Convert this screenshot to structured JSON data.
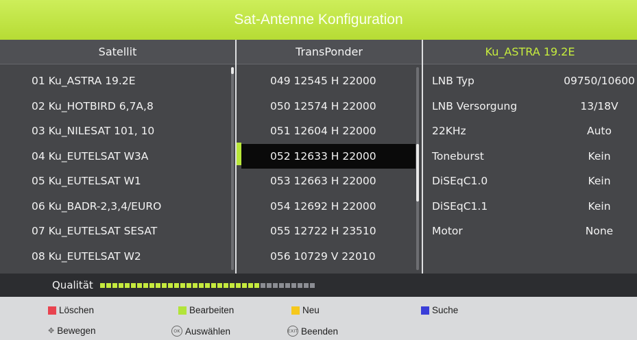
{
  "title": "Sat-Antenne Konfiguration",
  "columns": {
    "satellite_header": "Satellit",
    "transponder_header": "TransPonder",
    "selected_satellite_header": "Ku_ASTRA 19.2E"
  },
  "satellites": [
    "01 Ku_ASTRA 19.2E",
    "02 Ku_HOTBIRD 6,7A,8",
    "03 Ku_NILESAT 101, 10",
    "04 Ku_EUTELSAT W3A",
    "05 Ku_EUTELSAT W1",
    "06 Ku_BADR-2,3,4/EURO",
    "07 Ku_EUTELSAT SESAT",
    "08 Ku_EUTELSAT W2"
  ],
  "transponders": [
    "049 12545 H 22000",
    "050 12574 H 22000",
    "051 12604 H 22000",
    "052 12633 H 22000",
    "053 12663 H 22000",
    "054 12692 H 22000",
    "055 12722 H 23510",
    "056 10729 V 22010"
  ],
  "selected_transponder_index": 3,
  "settings": [
    {
      "label": "LNB Typ",
      "value": "09750/10600"
    },
    {
      "label": "LNB Versorgung",
      "value": "13/18V"
    },
    {
      "label": "22KHz",
      "value": "Auto"
    },
    {
      "label": "Toneburst",
      "value": "Kein"
    },
    {
      "label": "DiSEqC1.0",
      "value": "Kein"
    },
    {
      "label": "DiSEqC1.1",
      "value": "Kein"
    },
    {
      "label": "Motor",
      "value": "None"
    }
  ],
  "quality": {
    "label": "Qualität",
    "level": 0.74,
    "segments": 35
  },
  "legend": {
    "delete": "Löschen",
    "edit": "Bearbeiten",
    "new": "Neu",
    "search": "Suche",
    "move": "Bewegen",
    "select": "Auswählen",
    "exit": "Beenden",
    "ok_icon_text": "OK",
    "exit_icon_text": "EXIT"
  },
  "colors": {
    "accent": "#c6ec3e",
    "red": "#e8434f",
    "green": "#b2e43a",
    "yellow": "#f6c81c",
    "blue": "#3a3ed8"
  }
}
